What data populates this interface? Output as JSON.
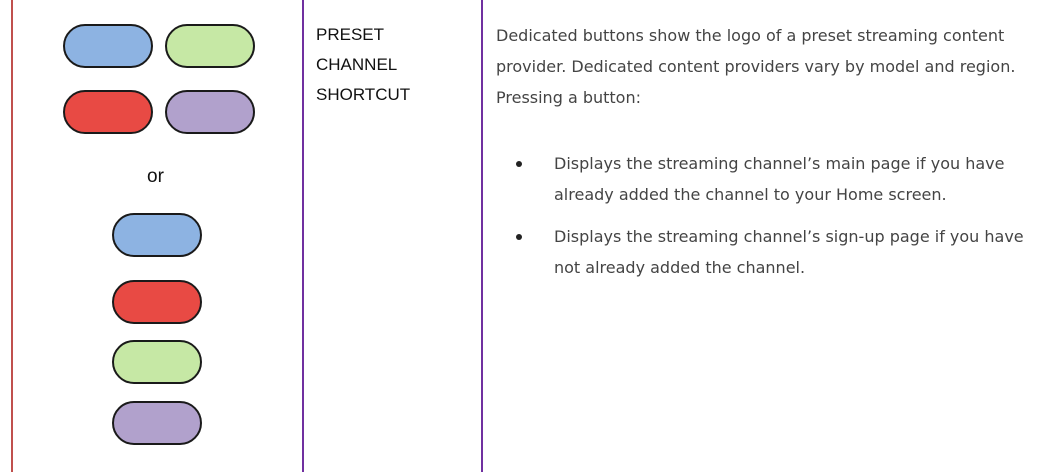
{
  "colors": {
    "blue": "#8db3e2",
    "green": "#c6e8a5",
    "red": "#e84a44",
    "purple": "#b1a1cc",
    "left_border": "#c0504d",
    "column_divider": "#7030a0"
  },
  "illustration": {
    "grid_buttons": [
      "blue",
      "green",
      "red",
      "purple"
    ],
    "separator_label": "or",
    "stacked_buttons": [
      "blue",
      "red",
      "green",
      "purple"
    ]
  },
  "feature_name": {
    "line1": "PRESET",
    "line2": "CHANNEL",
    "line3": "SHORTCUT"
  },
  "description": {
    "intro": "Dedicated buttons show the logo of a preset streaming content provider. Dedicated content providers vary by model and region. Pressing a button:",
    "bullets": [
      "Displays the streaming channel’s main page if you have already added the channel to your Home screen.",
      "Displays the streaming channel’s sign-up page if you have not already added the channel."
    ]
  }
}
